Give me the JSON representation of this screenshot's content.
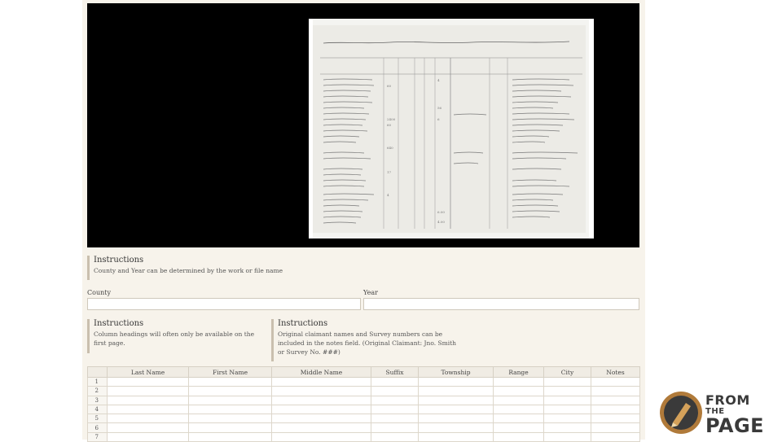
{
  "document_image": {
    "header_text": "Abstract of Field Notes of Surveys entered in the County of ... year 1844",
    "columns": [
      "Claimants",
      "Acres",
      "Distance",
      "Section",
      "Surveyor",
      "Original Claimant",
      "Survey Remarks"
    ]
  },
  "instructions": [
    {
      "heading": "Instructions",
      "text": "County and Year can be determined by the work or file name"
    },
    {
      "heading": "Instructions",
      "text": "Column headings will often only be available on the first page."
    },
    {
      "heading": "Instructions",
      "text": "Original claimant names and Survey numbers can be included in the notes field. (Original Claimant: Jno. Smith or Survey No. ###)"
    }
  ],
  "fields": {
    "county_label": "County",
    "county_value": "",
    "year_label": "Year",
    "year_value": ""
  },
  "table": {
    "headers": [
      "",
      "Last Name",
      "First Name",
      "Middle Name",
      "Suffix",
      "Township",
      "Range",
      "City",
      "Notes"
    ],
    "rows": [
      "1",
      "2",
      "3",
      "4",
      "5",
      "6",
      "7"
    ]
  },
  "logo": {
    "line1": "FROM",
    "line2": "THE",
    "line3": "PAGE"
  },
  "colors": {
    "panel_bg": "#f7f3eb",
    "viewer_bg": "#000000",
    "accent_border": "#c9bfae",
    "logo_ring": "#b07a3a"
  }
}
